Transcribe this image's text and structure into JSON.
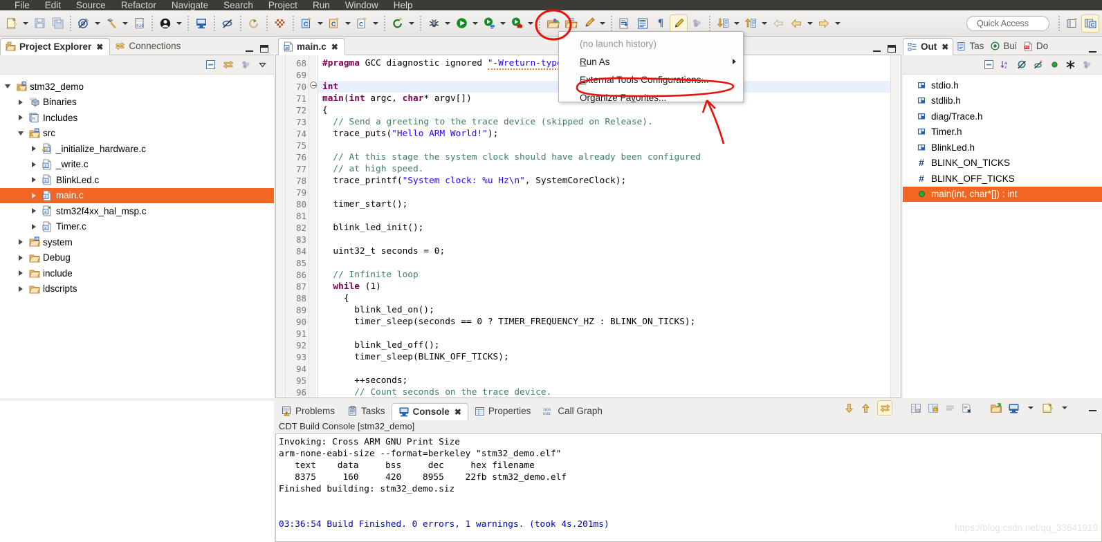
{
  "menu": {
    "items": [
      "File",
      "Edit",
      "Source",
      "Refactor",
      "Navigate",
      "Search",
      "Project",
      "Run",
      "Window",
      "Help"
    ]
  },
  "toolbar": {
    "quick_access_placeholder": "Quick Access",
    "icons": [
      "new-file-icon",
      "save-icon",
      "save-all-icon",
      "skip-breakpoints-icon",
      "build-hammer-icon",
      "binary-icon",
      "user-profile-icon",
      "open-console-icon",
      "no-pin-icon",
      "refresh-icon",
      "checkered-icon",
      "new-c-project-icon",
      "new-c-class-icon",
      "new-c-file-icon",
      "debug-bug-icon",
      "run-icon",
      "run-config-icon",
      "external-tools-icon",
      "open-type-icon",
      "open-resource-icon",
      "highlight-pen-icon",
      "next-annotation-icon",
      "show-whitespace-icon",
      "pilcrow-icon",
      "marker-pen-icon",
      "previous-edit-icon",
      "back-icon",
      "forward-icon"
    ]
  },
  "popup_menu": {
    "name": "external-tools-dropdown",
    "items": [
      {
        "label": "(no launch history)",
        "disabled": true,
        "submenu": false
      },
      {
        "label": "Run As",
        "mnemonic": "R",
        "disabled": false,
        "submenu": true
      },
      {
        "label": "External Tools Configurations...",
        "mnemonic": "E",
        "disabled": false,
        "submenu": false
      },
      {
        "label": "Organize Favorites...",
        "mnemonic": "v",
        "disabled": false,
        "submenu": false
      }
    ]
  },
  "left_panel": {
    "tabs": [
      {
        "label": "Project Explorer",
        "icon": "project-explorer-icon",
        "active": true
      },
      {
        "label": "Connections",
        "icon": "connections-icon",
        "active": false
      }
    ],
    "view_toolbar_icons": [
      "collapse-all-icon",
      "link-with-editor-icon",
      "view-menu-dots-icon",
      "view-menu-chevron-icon"
    ],
    "tree": [
      {
        "label": "stm32_demo",
        "indent": 0,
        "twisty": "down",
        "icon": "c-project-warning-icon",
        "selected": false
      },
      {
        "label": "Binaries",
        "indent": 1,
        "twisty": "right",
        "icon": "binaries-icon",
        "selected": false
      },
      {
        "label": "Includes",
        "indent": 1,
        "twisty": "right",
        "icon": "includes-icon",
        "selected": false
      },
      {
        "label": "src",
        "indent": 1,
        "twisty": "down",
        "icon": "source-folder-warning-icon",
        "selected": false
      },
      {
        "label": "_initialize_hardware.c",
        "indent": 2,
        "twisty": "right",
        "icon": "c-file-warning-icon",
        "selected": false
      },
      {
        "label": "_write.c",
        "indent": 2,
        "twisty": "right",
        "icon": "c-file-icon",
        "selected": false
      },
      {
        "label": "BlinkLed.c",
        "indent": 2,
        "twisty": "right",
        "icon": "c-file-icon",
        "selected": false
      },
      {
        "label": "main.c",
        "indent": 2,
        "twisty": "right",
        "icon": "c-file-icon",
        "selected": true
      },
      {
        "label": "stm32f4xx_hal_msp.c",
        "indent": 2,
        "twisty": "right",
        "icon": "c-file-excluded-icon",
        "selected": false
      },
      {
        "label": "Timer.c",
        "indent": 2,
        "twisty": "right",
        "icon": "c-file-icon",
        "selected": false
      },
      {
        "label": "system",
        "indent": 1,
        "twisty": "right",
        "icon": "source-folder-icon",
        "selected": false
      },
      {
        "label": "Debug",
        "indent": 1,
        "twisty": "right",
        "icon": "folder-icon",
        "selected": false
      },
      {
        "label": "include",
        "indent": 1,
        "twisty": "right",
        "icon": "folder-icon",
        "selected": false
      },
      {
        "label": "ldscripts",
        "indent": 1,
        "twisty": "right",
        "icon": "folder-icon",
        "selected": false
      }
    ]
  },
  "editor": {
    "tab": {
      "label": "main.c",
      "icon": "c-file-icon",
      "close": "⌧"
    },
    "first_line_number": 68,
    "highlight_line": 70,
    "fold_line": 70,
    "lines": [
      {
        "n": 68,
        "tokens": [
          {
            "t": "#pragma",
            "c": "pp"
          },
          {
            "t": " GCC diagnostic ignored ",
            "c": "n"
          },
          {
            "t": "\"-Wreturn-type\"",
            "c": "s"
          }
        ]
      },
      {
        "n": 69,
        "tokens": []
      },
      {
        "n": 70,
        "tokens": [
          {
            "t": "int",
            "c": "k"
          }
        ]
      },
      {
        "n": 71,
        "tokens": [
          {
            "t": "main",
            "c": "kb"
          },
          {
            "t": "(",
            "c": "n"
          },
          {
            "t": "int",
            "c": "k"
          },
          {
            "t": " argc, ",
            "c": "n"
          },
          {
            "t": "char",
            "c": "k"
          },
          {
            "t": "* argv[])",
            "c": "n"
          }
        ]
      },
      {
        "n": 72,
        "tokens": [
          {
            "t": "{",
            "c": "n"
          }
        ]
      },
      {
        "n": 73,
        "tokens": [
          {
            "t": "  // Send a greeting to the trace device (skipped on Release).",
            "c": "c"
          }
        ]
      },
      {
        "n": 74,
        "tokens": [
          {
            "t": "  trace_puts(",
            "c": "n"
          },
          {
            "t": "\"Hello ARM World!\"",
            "c": "s"
          },
          {
            "t": ");",
            "c": "n"
          }
        ]
      },
      {
        "n": 75,
        "tokens": []
      },
      {
        "n": 76,
        "tokens": [
          {
            "t": "  // At this stage the system clock should have already been configured",
            "c": "c"
          }
        ]
      },
      {
        "n": 77,
        "tokens": [
          {
            "t": "  // at high speed.",
            "c": "c"
          }
        ]
      },
      {
        "n": 78,
        "tokens": [
          {
            "t": "  trace_printf(",
            "c": "n"
          },
          {
            "t": "\"System clock: %u Hz\\n\"",
            "c": "s"
          },
          {
            "t": ", SystemCoreClock);",
            "c": "n"
          }
        ]
      },
      {
        "n": 79,
        "tokens": []
      },
      {
        "n": 80,
        "tokens": [
          {
            "t": "  timer_start();",
            "c": "n"
          }
        ]
      },
      {
        "n": 81,
        "tokens": []
      },
      {
        "n": 82,
        "tokens": [
          {
            "t": "  blink_led_init();",
            "c": "n"
          }
        ]
      },
      {
        "n": 83,
        "tokens": []
      },
      {
        "n": 84,
        "tokens": [
          {
            "t": "  uint32_t seconds = 0;",
            "c": "n"
          }
        ]
      },
      {
        "n": 85,
        "tokens": []
      },
      {
        "n": 86,
        "tokens": [
          {
            "t": "  // Infinite loop",
            "c": "c"
          }
        ]
      },
      {
        "n": 87,
        "tokens": [
          {
            "t": "  ",
            "c": "n"
          },
          {
            "t": "while",
            "c": "k"
          },
          {
            "t": " (1)",
            "c": "n"
          }
        ]
      },
      {
        "n": 88,
        "tokens": [
          {
            "t": "    {",
            "c": "n"
          }
        ]
      },
      {
        "n": 89,
        "tokens": [
          {
            "t": "      blink_led_on();",
            "c": "n"
          }
        ]
      },
      {
        "n": 90,
        "tokens": [
          {
            "t": "      timer_sleep(seconds == 0 ? TIMER_FREQUENCY_HZ : BLINK_ON_TICKS);",
            "c": "n"
          }
        ]
      },
      {
        "n": 91,
        "tokens": []
      },
      {
        "n": 92,
        "tokens": [
          {
            "t": "      blink_led_off();",
            "c": "n"
          }
        ]
      },
      {
        "n": 93,
        "tokens": [
          {
            "t": "      timer_sleep(BLINK_OFF_TICKS);",
            "c": "n"
          }
        ]
      },
      {
        "n": 94,
        "tokens": []
      },
      {
        "n": 95,
        "tokens": [
          {
            "t": "      ++seconds;",
            "c": "n"
          }
        ]
      },
      {
        "n": 96,
        "tokens": [
          {
            "t": "      // Count seconds on the trace device.",
            "c": "c"
          }
        ]
      }
    ]
  },
  "right_panel": {
    "tabs": [
      {
        "label": "Out",
        "icon": "outline-icon",
        "active": true
      },
      {
        "label": "Tas",
        "icon": "tasks-icon",
        "active": false
      },
      {
        "label": "Bui",
        "icon": "build-targets-icon",
        "active": false
      },
      {
        "label": "Do",
        "icon": "documents-pdf-icon",
        "active": false
      }
    ],
    "view_toolbar_icons": [
      "collapse-all-icon",
      "sort-az-icon",
      "hide-fields-icon",
      "hide-static-icon",
      "hide-nonpublic-icon",
      "hide-macros-icon",
      "view-menu-dots-icon"
    ],
    "items": [
      {
        "label": "stdio.h",
        "icon": "include-icon",
        "selected": false
      },
      {
        "label": "stdlib.h",
        "icon": "include-icon",
        "selected": false
      },
      {
        "label": "diag/Trace.h",
        "icon": "include-icon",
        "selected": false
      },
      {
        "label": "Timer.h",
        "icon": "include-icon",
        "selected": false
      },
      {
        "label": "BlinkLed.h",
        "icon": "include-icon",
        "selected": false
      },
      {
        "label": "BLINK_ON_TICKS",
        "icon": "macro-hash-icon",
        "selected": false
      },
      {
        "label": "BLINK_OFF_TICKS",
        "icon": "macro-hash-icon",
        "selected": false
      },
      {
        "label": "main(int, char*[]) : int",
        "icon": "public-method-icon",
        "selected": true
      }
    ]
  },
  "bottom_panel": {
    "tabs": [
      {
        "label": "Problems",
        "icon": "problems-icon",
        "active": false
      },
      {
        "label": "Tasks",
        "icon": "tasks-icon",
        "active": false
      },
      {
        "label": "Console",
        "icon": "console-icon",
        "active": true
      },
      {
        "label": "Properties",
        "icon": "properties-icon",
        "active": false
      },
      {
        "label": "Call Graph",
        "icon": "call-graph-icon",
        "active": false
      }
    ],
    "toolbar_icons": [
      "scroll-down-icon",
      "scroll-up-icon",
      "scroll-lock-icon",
      "save-console-icon",
      "pin-console-icon",
      "clear-console-icon",
      "remove-console-icon",
      "open-console-icon",
      "display-console-icon",
      "display-console-chevron-icon",
      "new-console-icon",
      "new-console-chevron-icon"
    ],
    "console_title": "CDT Build Console [stm32_demo]",
    "lines": [
      {
        "text": "Invoking: Cross ARM GNU Print Size",
        "blue": false
      },
      {
        "text": "arm-none-eabi-size --format=berkeley \"stm32_demo.elf\"",
        "blue": false
      },
      {
        "text": "   text\t   data\t    bss\t    dec\t    hex\tfilename",
        "blue": false
      },
      {
        "text": "   8375\t    160\t    420\t   8955\t   22fb\tstm32_demo.elf",
        "blue": false
      },
      {
        "text": "Finished building: stm32_demo.siz",
        "blue": false
      },
      {
        "text": "",
        "blue": false
      },
      {
        "text": "",
        "blue": false
      },
      {
        "text": "03:36:54 Build Finished. 0 errors, 1 warnings. (took 4s.201ms)",
        "blue": true
      }
    ]
  },
  "annotations": {
    "circle_toolbar": "red-circle-around-external-tools-button",
    "circle_menu_item": "red-ellipse-around-external-tools-configurations",
    "arrow": "red-arrow-pointing-up-to-menu-item",
    "color": "#e8120c"
  },
  "watermark": {
    "text": "https://blog.csdn.net/qq_33641919"
  }
}
